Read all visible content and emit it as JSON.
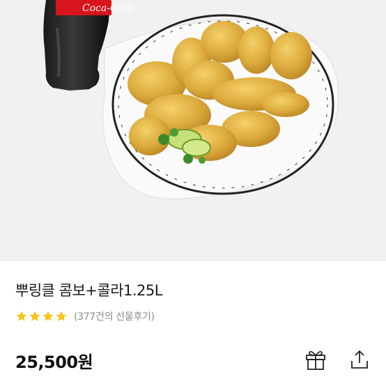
{
  "product": {
    "title": "뿌링클 콤보+콜라1.25L",
    "rating_stars": 4,
    "review_text": "(377건의 선물후기)",
    "price": "25,500원",
    "image": {
      "bottle_label": "Coca-Cola"
    }
  },
  "actions": {
    "gift_icon": "gift-icon",
    "share_icon": "share-icon"
  },
  "colors": {
    "star": "#f5c518",
    "hero_background": "#f1f1f1",
    "price_text": "#111111",
    "secondary_text": "#8a8a8a"
  }
}
